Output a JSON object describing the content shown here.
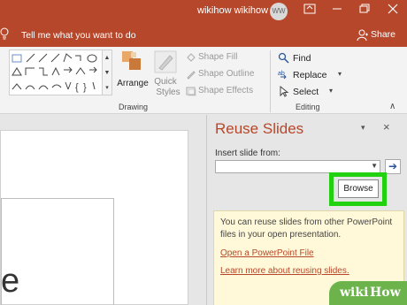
{
  "titlebar": {
    "user_name": "wikihow wikihow",
    "avatar_initials": "WW"
  },
  "tellbar": {
    "tell_me": "Tell me what you want to do",
    "share": "Share"
  },
  "ribbon": {
    "arrange": "Arrange",
    "quick_styles_1": "Quick",
    "quick_styles_2": "Styles",
    "shape_fill": "Shape Fill",
    "shape_outline": "Shape Outline",
    "shape_effects": "Shape Effects",
    "drawing_group": "Drawing",
    "find": "Find",
    "replace": "Replace",
    "select": "Select",
    "editing_group": "Editing"
  },
  "slide": {
    "visible_letter": "e"
  },
  "pane": {
    "title": "Reuse Slides",
    "insert_label": "Insert slide from:",
    "insert_value": "",
    "browse": "Browse",
    "info": "You can reuse slides from other PowerPoint files in your open presentation.",
    "link_open": "Open a PowerPoint File",
    "link_learn": "Learn more about reusing slides."
  },
  "watermark": {
    "wiki": "wiki",
    "how": "How"
  },
  "colors": {
    "accent": "#b7472a",
    "highlight": "#22d10f"
  }
}
